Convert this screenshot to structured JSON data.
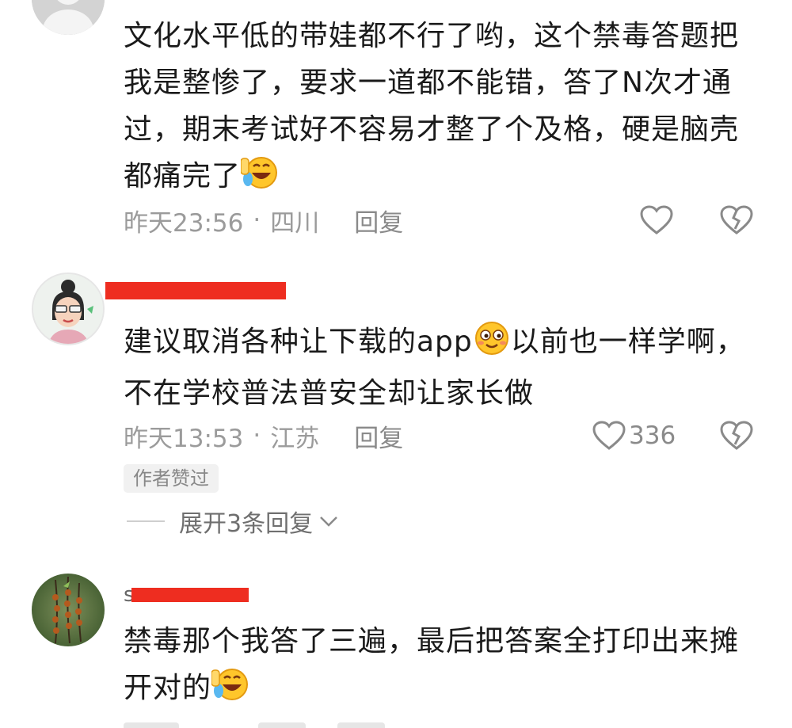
{
  "comments": [
    {
      "text": "文化水平低的带娃都不行了哟，这个禁毒答题把我是整惨了，要求一道都不能错，答了N次才通过，期末考试好不容易才整了个及格，硬是脑壳都痛完了",
      "time": "昨天23:56",
      "location": "四川",
      "reply": "回复",
      "emoji": "laugh-cry-emoji"
    },
    {
      "text_a": "建议取消各种让下载的app",
      "text_b": "以前也一样学啊，不在学校普法普安全却让家长做",
      "time": "昨天13:53",
      "location": "江苏",
      "reply": "回复",
      "likes": "336",
      "badge": "作者赞过",
      "expand": "展开3条回复",
      "emoji": "smile-emoji"
    },
    {
      "username_fragment": "s",
      "text": "禁毒那个我答了三遍，最后把答案全打印出来摊开对的",
      "emoji": "laugh-cry-emoji"
    }
  ],
  "separator": "·",
  "colors": {
    "redaction": "#ee2d20",
    "meta": "#9b9b9b"
  }
}
